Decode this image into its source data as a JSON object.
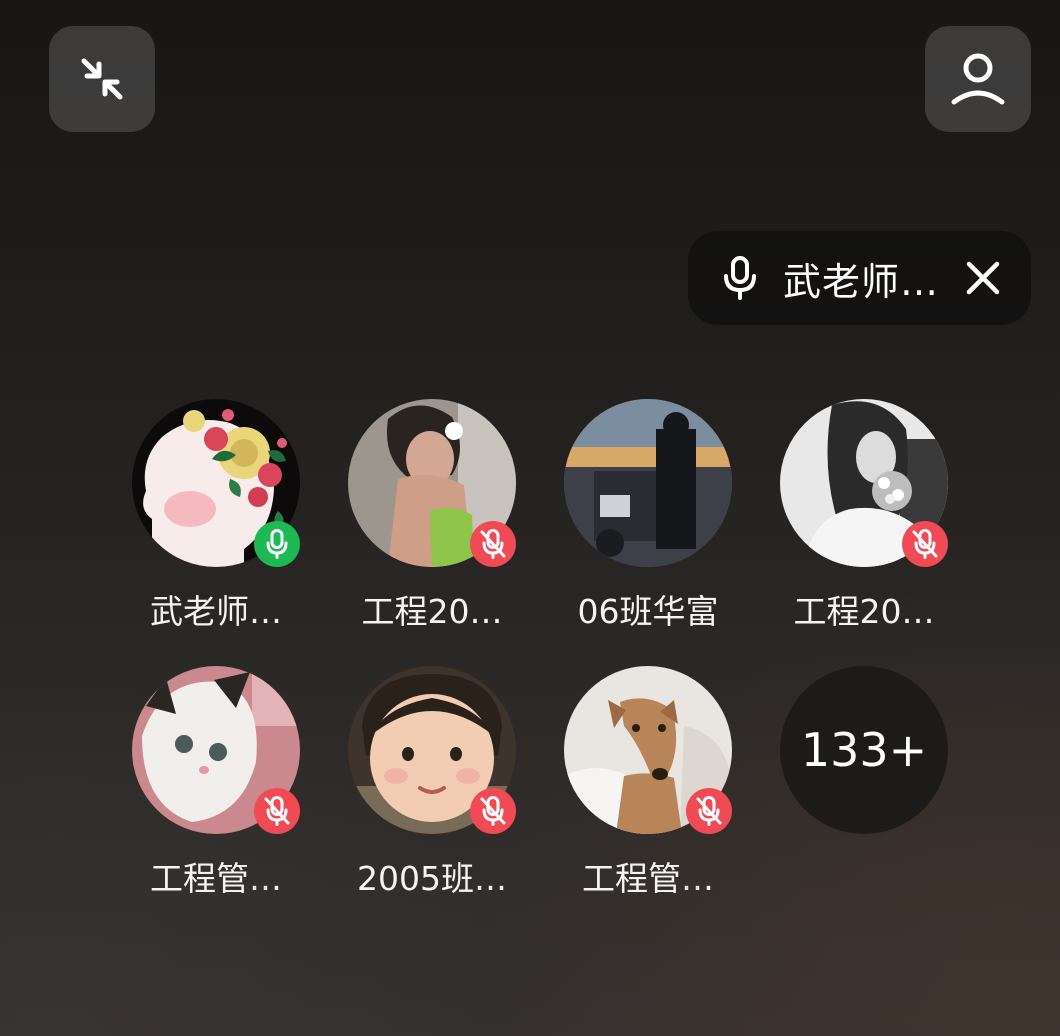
{
  "header": {
    "minimize_icon": "collapse-arrows-icon",
    "profile_icon": "person-icon"
  },
  "active_speaker": {
    "name": "武老师…",
    "icon": "microphone-icon",
    "close_icon": "close-icon"
  },
  "members": [
    {
      "name": "武老师…",
      "mic": "on"
    },
    {
      "name": "工程20…",
      "mic": "muted"
    },
    {
      "name": "06班华富",
      "mic": "none"
    },
    {
      "name": "工程20…",
      "mic": "muted"
    },
    {
      "name": "工程管…",
      "mic": "muted"
    },
    {
      "name": "2005班…",
      "mic": "muted"
    },
    {
      "name": "工程管…",
      "mic": "muted"
    }
  ],
  "more_count": "133+",
  "colors": {
    "mic_on": "#1db954",
    "mic_muted": "#f04a55"
  }
}
